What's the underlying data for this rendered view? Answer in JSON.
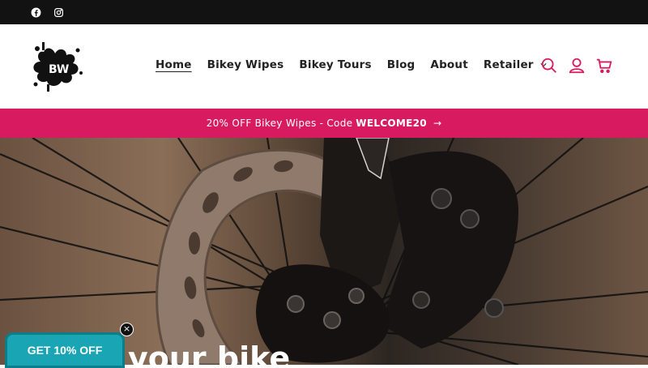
{
  "social": [
    {
      "name": "facebook-icon"
    },
    {
      "name": "instagram-icon"
    }
  ],
  "logo": {
    "text": "BW"
  },
  "nav": {
    "items": [
      {
        "label": "Home",
        "active": true
      },
      {
        "label": "Bikey Wipes"
      },
      {
        "label": "Bikey Tours"
      },
      {
        "label": "Blog"
      },
      {
        "label": "About"
      },
      {
        "label": "Retailer"
      }
    ]
  },
  "header_icons": [
    "search-icon",
    "account-icon",
    "cart-icon"
  ],
  "promo": {
    "text": "20% OFF Bikey Wipes - Code",
    "code": "WELCOME20",
    "arrow": "→"
  },
  "hero": {
    "title_partial": "your bike"
  },
  "discount_tab": {
    "label": "GET 10% OFF",
    "close": "×"
  },
  "colors": {
    "accent": "#d81b60",
    "topbar": "#121212",
    "discount": "#1aa5b5"
  }
}
